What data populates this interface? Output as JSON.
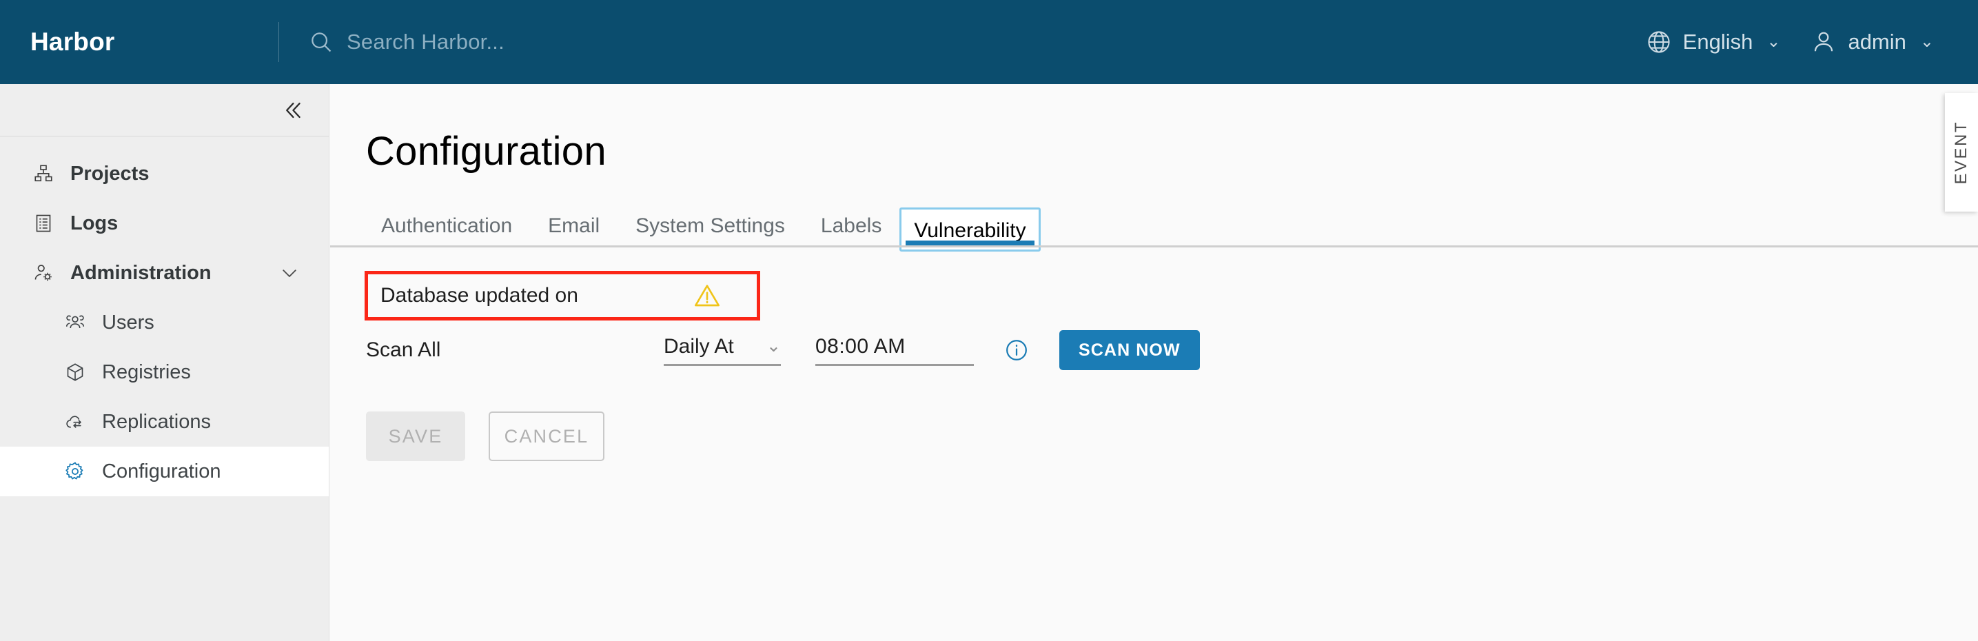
{
  "header": {
    "brand": "Harbor",
    "search": {
      "placeholder": "Search Harbor...",
      "icon": "search-icon"
    },
    "language": {
      "label": "English",
      "icon": "globe-icon",
      "caret": "⌄"
    },
    "user": {
      "label": "admin",
      "icon": "user-icon",
      "caret": "⌄"
    }
  },
  "sidebar": {
    "collapse_icon": "double-chevron-left-icon",
    "items": [
      {
        "label": "Projects",
        "icon": "projects-icon",
        "level": "top",
        "selected": false
      },
      {
        "label": "Logs",
        "icon": "logs-icon",
        "level": "top",
        "selected": false
      },
      {
        "label": "Administration",
        "icon": "administration-icon",
        "level": "top",
        "selected": false,
        "expand_icon": "chevron-down-icon"
      },
      {
        "label": "Users",
        "icon": "users-icon",
        "level": "sub",
        "selected": false
      },
      {
        "label": "Registries",
        "icon": "registries-icon",
        "level": "sub",
        "selected": false
      },
      {
        "label": "Replications",
        "icon": "replications-icon",
        "level": "sub",
        "selected": false
      },
      {
        "label": "Configuration",
        "icon": "gear-icon",
        "level": "sub",
        "selected": true
      }
    ]
  },
  "main": {
    "title": "Configuration",
    "tabs": [
      {
        "label": "Authentication",
        "active": false
      },
      {
        "label": "Email",
        "active": false
      },
      {
        "label": "System Settings",
        "active": false
      },
      {
        "label": "Labels",
        "active": false
      },
      {
        "label": "Vulnerability",
        "active": true
      }
    ],
    "vulnerability": {
      "database_updated_label": "Database updated on",
      "database_updated_value": "",
      "warning_icon": "warning-triangle-icon",
      "scan_all_label": "Scan All",
      "schedule_value": "Daily At",
      "schedule_caret": "⌄",
      "time_value": "08:00 AM",
      "info_icon": "info-circle-icon",
      "scan_now_label": "SCAN NOW"
    },
    "actions": {
      "save_label": "SAVE",
      "cancel_label": "CANCEL"
    }
  },
  "event_panel": {
    "label": "EVENT"
  },
  "colors": {
    "header_bg": "#0b4d6e",
    "sidebar_bg": "#eeeeee",
    "content_bg": "#fafafa",
    "accent_blue": "#1b7cb5",
    "focus_ring": "#89cbec",
    "highlight_red": "#fb2617",
    "warning_yellow": "#f0c419"
  }
}
